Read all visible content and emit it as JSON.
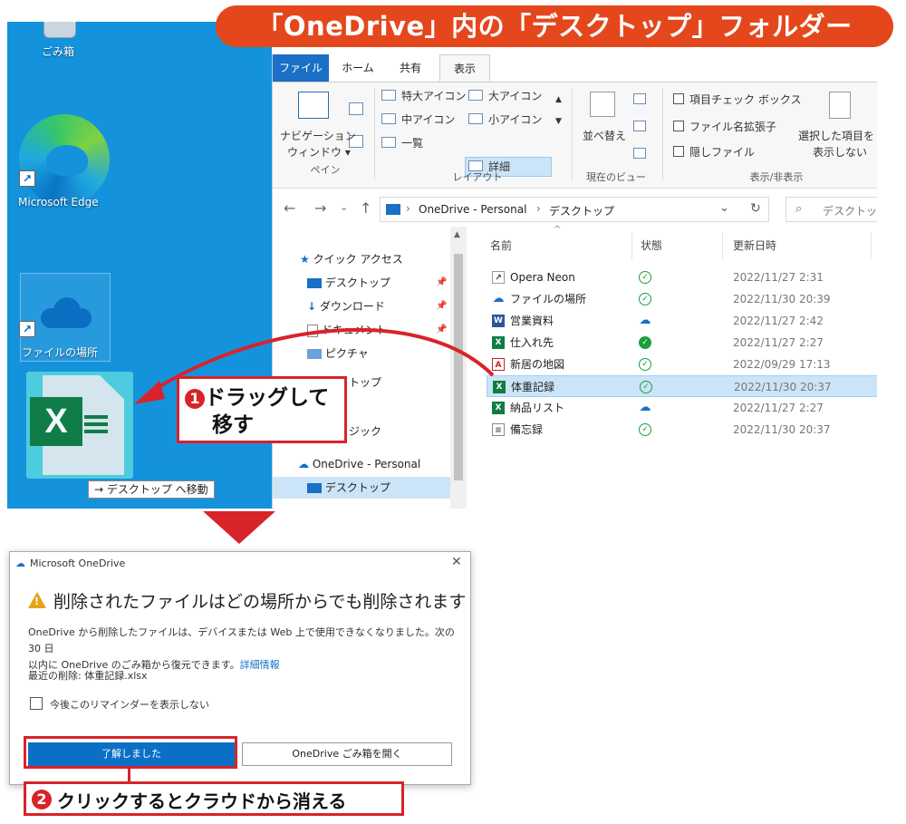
{
  "banner": "「OneDrive」内の「デスクトップ」フォルダー",
  "desktop": {
    "icons": [
      {
        "label": "ごみ箱"
      },
      {
        "label": "Microsoft Edge"
      },
      {
        "label": "ファイルの場所"
      }
    ],
    "drag_tooltip": "→ デスクトップ へ移動",
    "dragged_icon_letter": "X"
  },
  "explorer": {
    "tabs": [
      "ファイル",
      "ホーム",
      "共有",
      "表示"
    ],
    "active_tab": "表示",
    "ribbon": {
      "nav_pane_line1": "ナビゲーション",
      "nav_pane_line2": "ウィンドウ ▾",
      "pane_group": "ペイン",
      "layout": [
        "特大アイコン",
        "大アイコン",
        "中アイコン",
        "小アイコン",
        "一覧",
        "詳細"
      ],
      "layout_group": "レイアウト",
      "sort": "並べ替え",
      "current_view_group": "現在のビュー",
      "checks": [
        "項目チェック ボックス",
        "ファイル名拡張子",
        "隠しファイル"
      ],
      "hide_selected_line1": "選択した項目を",
      "hide_selected_line2": "表示しない",
      "show_hide_group": "表示/非表示"
    },
    "address": {
      "path": [
        "OneDrive - Personal",
        "デスクトップ"
      ],
      "search_placeholder": "デスクトップ"
    },
    "nav_items": [
      {
        "label": "クイック アクセス",
        "pinned": false
      },
      {
        "label": "デスクトップ",
        "pinned": true
      },
      {
        "label": "ダウンロード",
        "pinned": true
      },
      {
        "label": "ドキュメント",
        "pinned": true
      },
      {
        "label": "ピクチャ",
        "pinned": true
      },
      {
        "label": "トップ",
        "pinned": false
      },
      {
        "label": "ジック",
        "pinned": false
      },
      {
        "label": "OneDrive - Personal",
        "pinned": false
      },
      {
        "label": "デスクトップ",
        "pinned": false
      }
    ],
    "columns": [
      "名前",
      "状態",
      "更新日時"
    ],
    "files": [
      {
        "name": "Opera Neon",
        "status": "synced",
        "date": "2022/11/27 2:31",
        "icon": "shortcut"
      },
      {
        "name": "ファイルの場所",
        "status": "synced",
        "date": "2022/11/30 20:39",
        "icon": "onedrive"
      },
      {
        "name": "営業資料",
        "status": "cloud",
        "date": "2022/11/27 2:42",
        "icon": "word"
      },
      {
        "name": "仕入れ先",
        "status": "pinned",
        "date": "2022/11/27 2:27",
        "icon": "excel"
      },
      {
        "name": "新居の地図",
        "status": "synced",
        "date": "2022/09/29 17:13",
        "icon": "pdf"
      },
      {
        "name": "体重記録",
        "status": "synced",
        "date": "2022/11/30 20:37",
        "icon": "excel",
        "selected": true
      },
      {
        "name": "納品リスト",
        "status": "cloud",
        "date": "2022/11/27 2:27",
        "icon": "excel"
      },
      {
        "name": "備忘録",
        "status": "synced",
        "date": "2022/11/30 20:37",
        "icon": "text"
      }
    ]
  },
  "annotations": {
    "step1_num": "1",
    "step1_line1": "ドラッグして",
    "step1_line2": "移す",
    "step2_num": "2",
    "step2_text": "クリックするとクラウドから消える",
    "accent": "#d8232a"
  },
  "dialog": {
    "title": "Microsoft OneDrive",
    "heading": "削除されたファイルはどの場所からでも削除されます",
    "body_line1": "OneDrive から削除したファイルは、デバイスまたは Web 上で使用できなくなりました。次の30 日",
    "body_line2": "以内に OneDrive のごみ箱から復元できます。",
    "body_link": "詳細情報",
    "recent": "最近の削除: 体重記録.xlsx",
    "checkbox_label": "今後このリマインダーを表示しない",
    "primary_button": "了解しました",
    "secondary_button": "OneDrive ごみ箱を開く"
  }
}
